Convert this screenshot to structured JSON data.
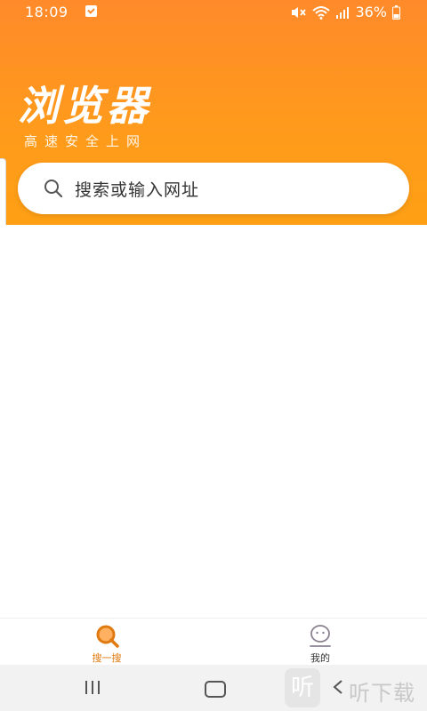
{
  "status_bar": {
    "time": "18:09",
    "battery": "36%"
  },
  "header": {
    "title": "浏览器",
    "subtitle": "高速安全上网"
  },
  "search": {
    "placeholder": "搜索或输入网址",
    "icon": "search-icon"
  },
  "bottom_nav": {
    "items": [
      {
        "label": "搜一搜",
        "icon": "search-magnifier-icon",
        "active": true
      },
      {
        "label": "我的",
        "icon": "profile-face-icon",
        "active": false
      }
    ]
  },
  "colors": {
    "accent": "#ff8a2a",
    "accent_light": "#ffa014",
    "active_tab": "#e07a10"
  },
  "watermark": {
    "logo": "听",
    "text": "听下载"
  }
}
